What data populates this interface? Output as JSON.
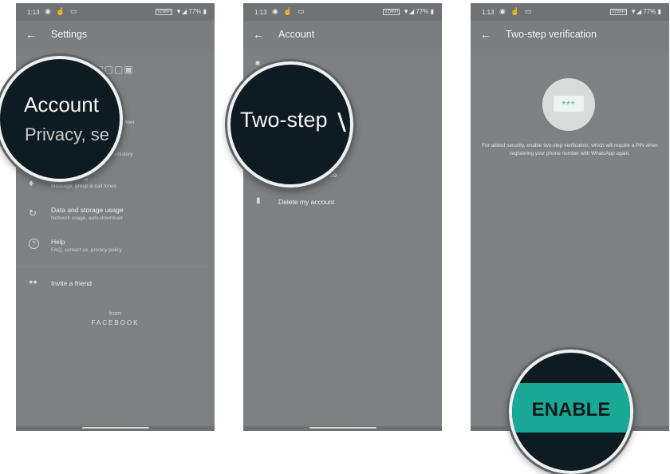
{
  "status_bar": {
    "time": "1:13",
    "icons": "◉ ☝ ▭",
    "badge": "VZWIFI",
    "battery": "▼◢ 77% ▮"
  },
  "screen1": {
    "title": "Settings",
    "blurred_name": "▢▣▢▢▣",
    "zoom_title": "Account",
    "zoom_sub": "Privacy, se",
    "partial_1": "mber",
    "partial_2": "d history",
    "items": [
      {
        "icon": "♪",
        "title": "Notifications",
        "sub": "Message, group & call tones"
      },
      {
        "icon": "↻",
        "title": "Data and storage usage",
        "sub": "Network usage, auto-download"
      },
      {
        "icon": "?",
        "title": "Help",
        "sub": "FAQ, contact us, privacy policy"
      }
    ],
    "invite": "Invite a friend",
    "from": "from",
    "brand": "FACEBOOK"
  },
  "screen2": {
    "title": "Account",
    "zoom_title": "Two-step",
    "partial": "ccount info",
    "delete": "Delete my account"
  },
  "screen3": {
    "title": "Two-step verification",
    "pin_dots": "***",
    "description": "For added security, enable two-step verification, which will require a PIN when registering your phone number with WhatsApp again.",
    "button": "ENABLE"
  },
  "colors": {
    "accent": "#1aa896",
    "lens_bg": "#0f1b22"
  }
}
